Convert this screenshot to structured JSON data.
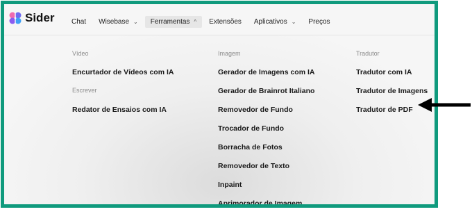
{
  "brand": {
    "name": "Sider"
  },
  "nav": {
    "items": [
      {
        "label": "Chat",
        "dropdown": false
      },
      {
        "label": "Wisebase",
        "dropdown": true
      },
      {
        "label": "Ferramentas",
        "dropdown": true,
        "active": true
      },
      {
        "label": "Extensões",
        "dropdown": false
      },
      {
        "label": "Aplicativos",
        "dropdown": true
      },
      {
        "label": "Preços",
        "dropdown": false
      }
    ]
  },
  "menu": {
    "columns": [
      {
        "sections": [
          {
            "title": "Vídeo",
            "items": [
              "Encurtador de Vídeos com IA"
            ]
          },
          {
            "title": "Escrever",
            "items": [
              "Redator de Ensaios com IA"
            ]
          }
        ]
      },
      {
        "sections": [
          {
            "title": "Imagem",
            "items": [
              "Gerador de Imagens com IA",
              "Gerador de Brainrot Italiano",
              "Removedor de Fundo",
              "Trocador de Fundo",
              "Borracha de Fotos",
              "Removedor de Texto",
              "Inpaint",
              "Aprimorador de Imagem"
            ]
          }
        ]
      },
      {
        "sections": [
          {
            "title": "Tradutor",
            "items": [
              "Tradutor com IA",
              "Tradutor de Imagens",
              "Tradutor de PDF"
            ]
          }
        ]
      }
    ]
  },
  "annotation": {
    "arrow_color": "#000000",
    "points_to": "Tradutor de PDF"
  },
  "colors": {
    "frame_border": "#0f9a7d"
  }
}
